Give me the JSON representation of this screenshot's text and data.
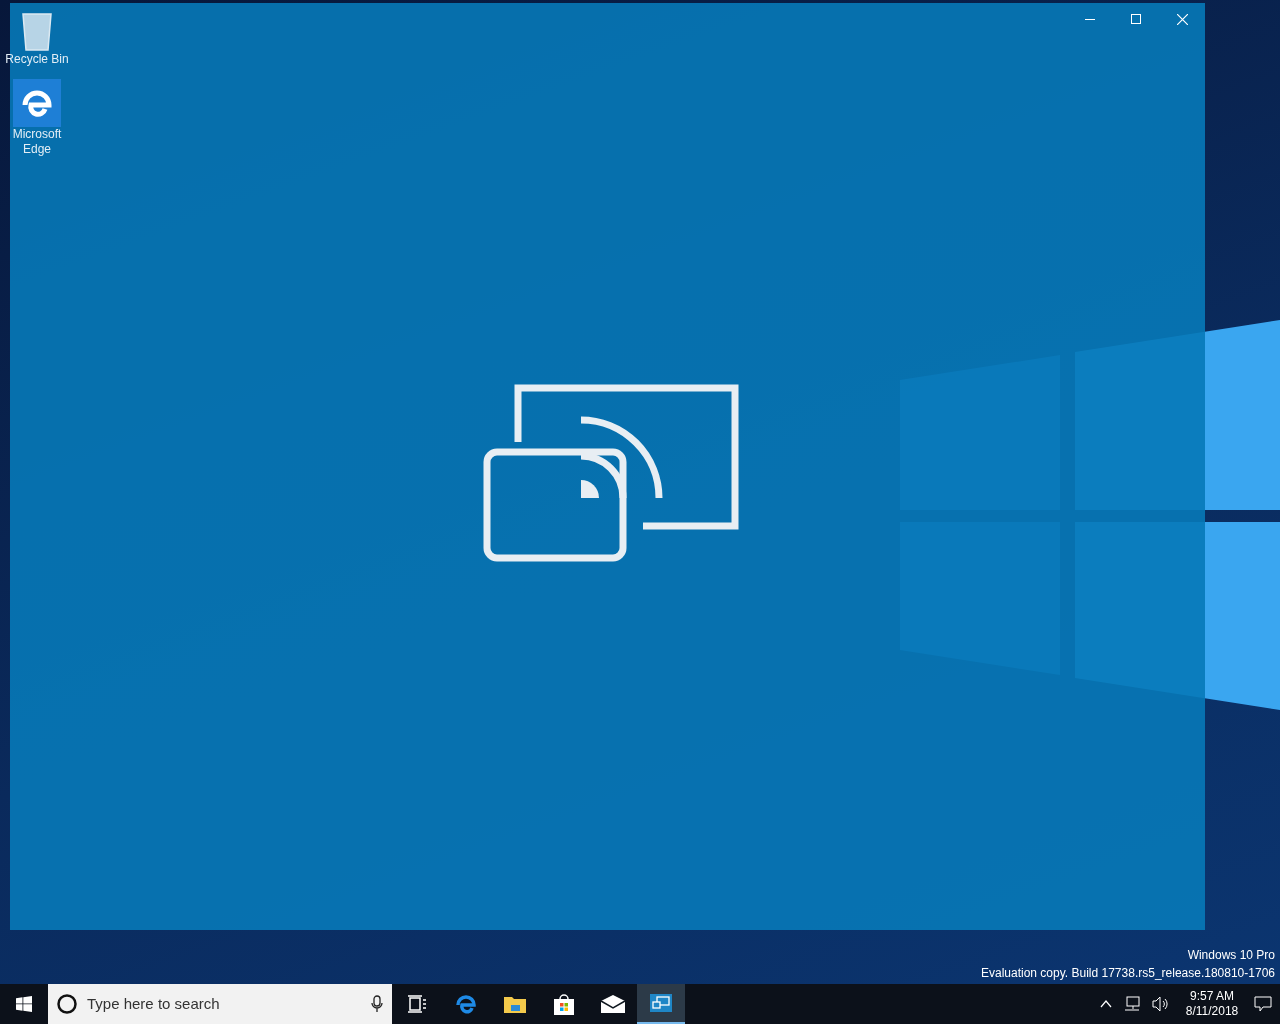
{
  "desktop": {
    "icons": [
      {
        "kind": "recycle-bin",
        "label": "Recycle Bin"
      },
      {
        "kind": "edge",
        "label": "Microsoft Edge"
      }
    ],
    "watermark_lines": [
      "Windows 10 Pro",
      "Evaluation copy. Build 17738.rs5_release.180810-1706"
    ]
  },
  "taskbar": {
    "search": {
      "placeholder": "Type here to search"
    },
    "apps": [
      {
        "kind": "task-view",
        "selected": false
      },
      {
        "kind": "edge",
        "selected": false
      },
      {
        "kind": "explorer",
        "selected": false
      },
      {
        "kind": "store",
        "selected": false
      },
      {
        "kind": "mail",
        "selected": false
      },
      {
        "kind": "connect",
        "selected": true
      }
    ],
    "tray": {
      "time": "9:57 AM",
      "date": "8/11/2018"
    }
  }
}
